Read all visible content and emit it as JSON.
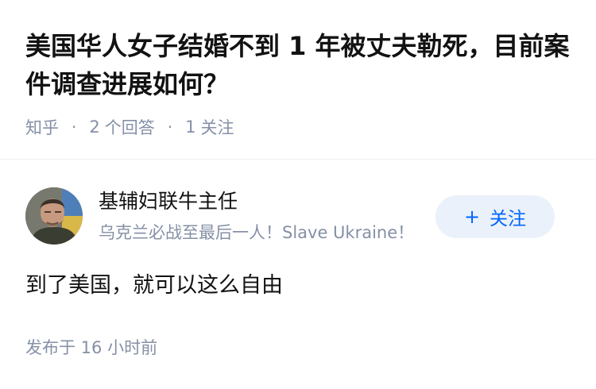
{
  "question": {
    "title": "美国华人女子结婚不到 1 年被丈夫勒死，目前案件调查进展如何？",
    "source": "知乎",
    "answer_count": "2",
    "answer_unit": "个回答",
    "follower_count": "1",
    "follower_unit": "关注",
    "separator": "·"
  },
  "author": {
    "name": "基辅妇联牛主任",
    "bio": "乌克兰必战至最后一人！Slave Ukraine！",
    "avatar_icon": "user-avatar-photo"
  },
  "follow_button": {
    "plus": "+",
    "label": "关注",
    "text_color": "#0066ff",
    "bg_color": "#ebf1fa"
  },
  "answer": {
    "content": "到了美国，就可以这么自由",
    "publish_time": "发布于 16 小时前"
  }
}
